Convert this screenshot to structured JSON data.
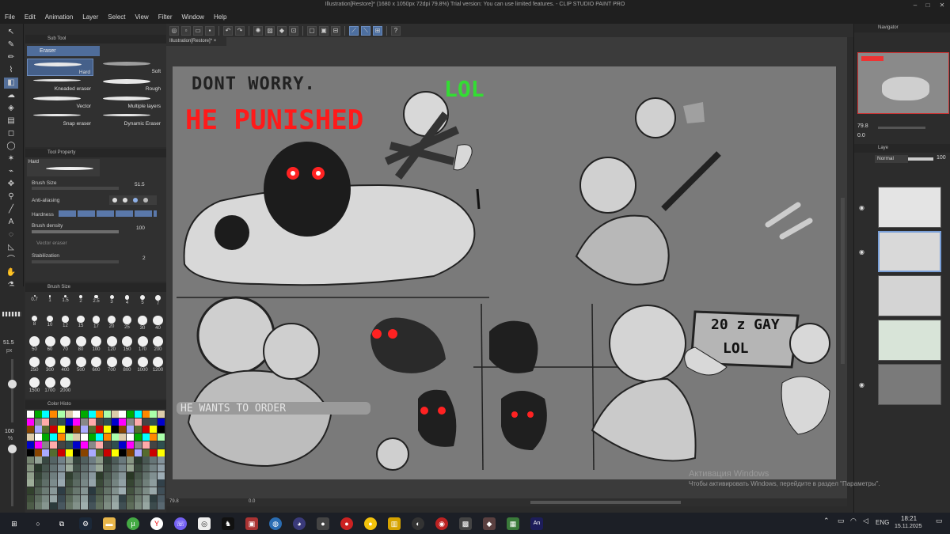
{
  "window": {
    "title": "Illustration[Restore]* (1680 x 1050px 72dpi 79.8%)  Trial version: You can use limited features. - CLIP STUDIO PAINT PRO"
  },
  "menu": [
    "File",
    "Edit",
    "Animation",
    "Layer",
    "Select",
    "View",
    "Filter",
    "Window",
    "Help"
  ],
  "document": {
    "tab_label": "Illustration[Restore]*",
    "zoom": "79.8",
    "rotation": "0.0"
  },
  "subtool": {
    "panel_title": "Sub Tool",
    "group": "Eraser",
    "brushes": [
      "Hard",
      "Soft",
      "Kneaded eraser",
      "Rough",
      "Vector",
      "Multiple layers",
      "Snap eraser",
      "Dynamic Eraser"
    ]
  },
  "toolprop": {
    "panel_title": "Tool Property",
    "preset": "Hard",
    "brush_size_label": "Brush Size",
    "brush_size_value": "51.5",
    "anti_alias_label": "Anti-aliasing",
    "hardness_label": "Hardness",
    "density_label": "Brush density",
    "density_value": "100",
    "vector_label": "Vector eraser",
    "stabilization_label": "Stabilization",
    "stabilization_value": "2"
  },
  "brushsize": {
    "panel_title": "Brush Size",
    "sizes": [
      "0.7",
      "1",
      "1.5",
      "2",
      "2.5",
      "3",
      "4",
      "5",
      "7",
      "8",
      "10",
      "12",
      "15",
      "17",
      "20",
      "25",
      "30",
      "40",
      "50",
      "60",
      "70",
      "80",
      "100",
      "120",
      "150",
      "170",
      "200",
      "250",
      "300",
      "400",
      "500",
      "600",
      "700",
      "800",
      "1000",
      "1200",
      "1500",
      "1700",
      "2000"
    ]
  },
  "sidebar_size": {
    "value": "51.5",
    "unit": "px"
  },
  "opacity": {
    "value": "100",
    "unit": "%"
  },
  "colorhist": {
    "panel_title": "Color Histo"
  },
  "navigator": {
    "panel_title": "Navigator",
    "zoom": "79.8",
    "angle": "0.0"
  },
  "layer": {
    "panel_title": "Laye",
    "blend_mode": "Normal",
    "opacity": "100"
  },
  "drawing_text": {
    "line1": "DONT WORRY.",
    "line2": "HE PUNISHED",
    "lol1": "LOL",
    "sign_line1": "20 z GAY",
    "sign_line2": "LOL",
    "caption": "HE WANTS TO ORDER"
  },
  "activation": {
    "title": "Активация Windows",
    "subtitle": "Чтобы активировать Windows, перейдите в раздел \"Параметры\"."
  },
  "taskbar": {
    "time": "18:21",
    "date": "15.11.2025",
    "lang": "ENG",
    "app_badge": "An"
  },
  "colors": {
    "accent": "#4f6d9b",
    "red_text": "#ff1a1a",
    "green_text": "#33dd33",
    "canvas_bg": "#7a7a7a"
  },
  "icons": [
    "windows-start-icon",
    "search-icon",
    "task-view-icon",
    "steam-icon",
    "folder-icon",
    "yandex-icon",
    "viber-icon",
    "clip-studio-icon"
  ]
}
